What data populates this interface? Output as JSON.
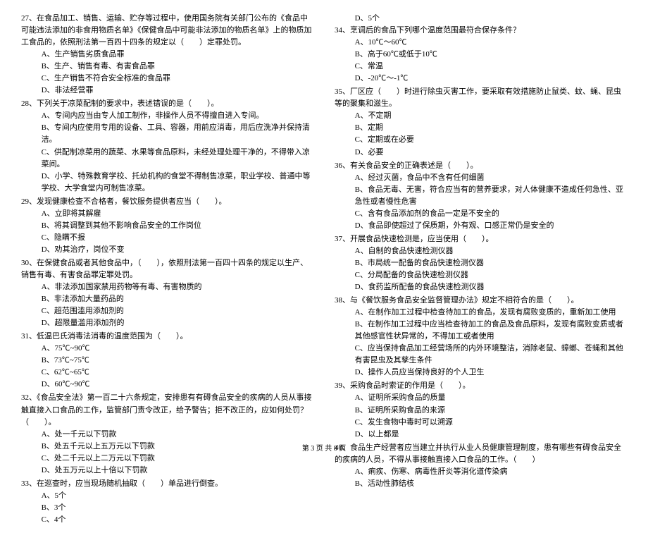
{
  "footer": "第 3 页 共 8 页",
  "left": {
    "q27": {
      "text": "27、在食品加工、销售、运输、贮存等过程中，使用国务院有关部门公布的《食品中可能违法添加的非食用物质名单》《保健食品中可能非法添加的物质名单》上的物质加工食品的，依照刑法第一百四十四条的规定以（　　）定罪处罚。",
      "a": "A、生产销售劣质食品罪",
      "b": "B、生产、销售有毒、有害食品罪",
      "c": "C、生产销售不符合安全标准的食品罪",
      "d": "D、非法经营罪"
    },
    "q28": {
      "text": "28、下列关于凉菜配制的要求中，表述错误的是（　　）。",
      "a": "A、专间内应当由专人加工制作，非操作人员不得擅自进入专间。",
      "b": "B、专间内应使用专用的设备、工具、容器，用前应消毒，用后应洗净并保持清洁。",
      "c": "C、供配制凉菜用的蔬菜、水果等食品原料，未经处理处理干净的，不得带入凉菜间。",
      "d": "D、小学、特殊教育学校、托幼机构的食堂不得制售凉菜，职业学校、普通中等学校、大学食堂内可制售凉菜。"
    },
    "q29": {
      "text": "29、发现健康检查不合格者，餐饮服务提供者应当（　　）。",
      "a": "A、立即将其解雇",
      "b": "B、将其调整到其他不影响食品安全的工作岗位",
      "c": "C、隐瞒不报",
      "d": "D、劝其治疗，岗位不变"
    },
    "q30": {
      "text": "30、在保健食品或者其他食品中，（　　），依照刑法第一百四十四条的规定以生产、销售有毒、有害食品罪定罪处罚。",
      "a": "A、非法添加国家禁用药物等有毒、有害物质的",
      "b": "B、非法添加大量药品的",
      "c": "C、超范围滥用添加剂的",
      "d": "D、超限量滥用添加剂的"
    },
    "q31": {
      "text": "31、低温巴氏消毒法消毒的温度范围为（　　）。",
      "a": "A、75℃~90℃",
      "b": "B、73℃~75℃",
      "c": "C、62℃~65℃",
      "d": "D、60℃~90℃"
    },
    "q32": {
      "text": "32、《食品安全法》第一百二十六条规定，安排患有有碍食品安全的疾病的人员从事接触直接入口食品的工作，监管部门责令改正，给予警告；拒不改正的，应如何处罚？（　　）。",
      "a": "A、处一千元以下罚款",
      "b": "B、处五千元以上五万元以下罚款",
      "c": "C、处二千元以上二万元以下罚款",
      "d": "D、处五万元以上十倍以下罚款"
    },
    "q33": {
      "text": "33、在巡查时，应当现场随机抽取（　　）单品进行倒查。",
      "a": "A、5个",
      "b": "B、3个",
      "c": "C、4个"
    }
  },
  "right": {
    "q33d": "D、5个",
    "q34": {
      "text": "34、烹调后的食品下列哪个温度范围最符合保存条件？",
      "a": "A、10℃～60℃",
      "b": "B、高于60℃或低于10℃",
      "c": "C、常温",
      "d": "D、-20℃～-1℃"
    },
    "q35": {
      "text": "35、厂区应（　　）时进行除虫灭害工作，要采取有效措施防止鼠类、蚊、蝇、昆虫等的聚集和滋生。",
      "a": "A、不定期",
      "b": "B、定期",
      "c": "C、定期或在必要",
      "d": "D、必要"
    },
    "q36": {
      "text": "36、有关食品安全的正确表述是（　　）。",
      "a": "A、经过灭菌，食品中不含有任何细菌",
      "b": "B、食品无毒、无害，符合应当有的营养要求，对人体健康不造成任何急性、亚急性或者慢性危害",
      "c": "C、含有食品添加剂的食品一定是不安全的",
      "d": "D、食品即使超过了保质期，外有观、口感正常仍是安全的"
    },
    "q37": {
      "text": "37、开展食品快速检测是，应当使用（　　）。",
      "a": "A、自制的食品快速检测仪器",
      "b": "B、市局统一配备的食品快速检测仪器",
      "c": "C、分局配备的食品快速检测仪器",
      "d": "D、食药监所配备的食品快速检测仪器"
    },
    "q38": {
      "text": "38、与《餐饮服务食品安全监督管理办法》规定不相符合的是（　　）。",
      "a": "A、在制作加工过程中检查待加工的食品，发现有腐败变质的，重新加工使用",
      "b": "B、在制作加工过程中应当检查待加工的食品及食品原料，发现有腐败变质或者其他感官性状异常的，不得加工或者使用",
      "c": "C、应当保持食品加工经营场所的内外环境整洁，消除老鼠、蟑螂、苍蝇和其他有害昆虫及其孳生条件",
      "d": "D、操作人员应当保持良好的个人卫生"
    },
    "q39": {
      "text": "39、采购食品时索证的作用是（　　）。",
      "a": "A、证明所采购食品的质量",
      "b": "B、证明所采购食品的来源",
      "c": "C、发生食物中毒时可以溯源",
      "d": "D、以上都是"
    },
    "q40": {
      "text": "40、食品生产经营者应当建立并执行从业人员健康管理制度，患有哪些有碍食品安全的疾病的人员，不得从事接触直接入口食品的工作。（　　）",
      "a": "A、痢疾、伤寒、病毒性肝炎等消化道传染病",
      "b": "B、活动性肺结核"
    }
  }
}
